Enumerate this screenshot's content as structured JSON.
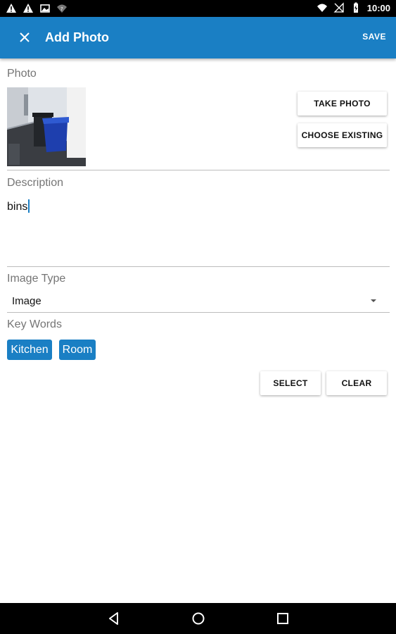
{
  "status_bar": {
    "time": "10:00",
    "left_icons": [
      "warning-icon",
      "warning-icon",
      "image-icon",
      "wifi-question-icon"
    ],
    "right_icons": [
      "wifi-icon",
      "signal-off-icon",
      "battery-charging-icon"
    ]
  },
  "app_bar": {
    "title": "Add Photo",
    "save_label": "SAVE",
    "close_icon": "close-icon",
    "background": "#1a7fc4"
  },
  "photo_section": {
    "label": "Photo",
    "take_photo_label": "TAKE PHOTO",
    "choose_existing_label": "CHOOSE EXISTING"
  },
  "description": {
    "label": "Description",
    "value": "bins"
  },
  "image_type": {
    "label": "Image Type",
    "selected": "Image"
  },
  "key_words": {
    "label": "Key Words",
    "chips": [
      "Kitchen",
      "Room"
    ],
    "select_label": "SELECT",
    "clear_label": "CLEAR"
  },
  "nav_bar": {
    "icons": [
      "back-icon",
      "home-icon",
      "recents-icon"
    ]
  }
}
